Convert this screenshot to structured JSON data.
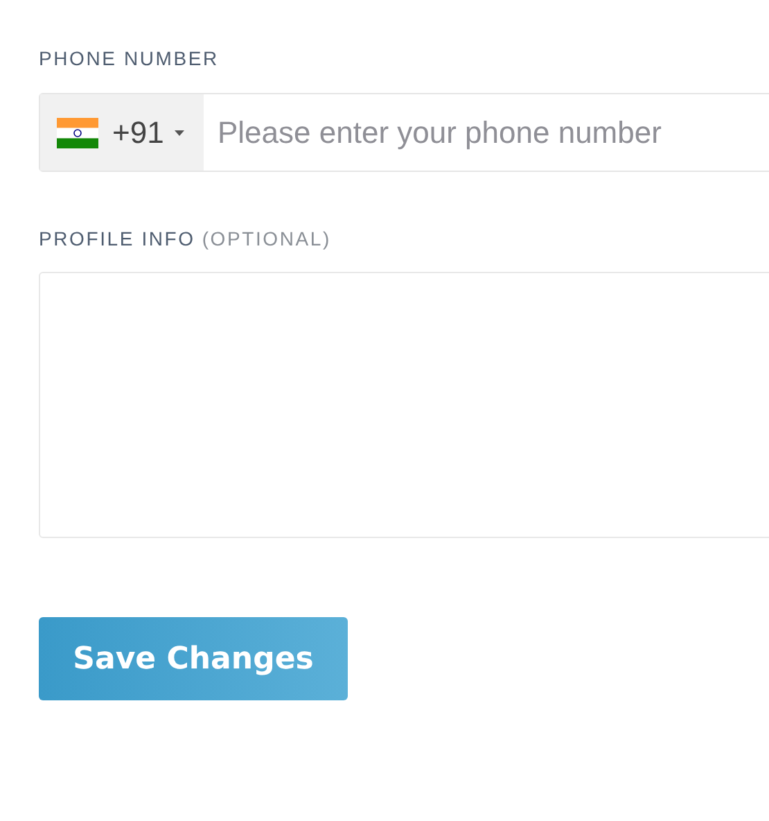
{
  "phone_number": {
    "label": "PHONE NUMBER",
    "country_code": "+91",
    "placeholder": "Please enter your phone number"
  },
  "profile_info": {
    "label": "PROFILE INFO",
    "note": "(OPTIONAL)"
  },
  "save_button": {
    "label": "Save Changes"
  }
}
